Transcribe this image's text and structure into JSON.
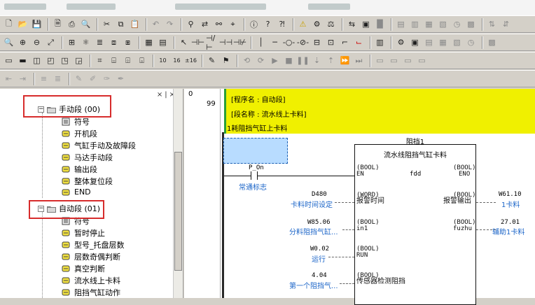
{
  "tree": {
    "header_dots": "×|×",
    "groups": [
      {
        "label": "手动段 (00)",
        "items": [
          "符号",
          "开机段",
          "气缸手动及故障段",
          "马达手动段",
          "输出段",
          "整体复位段",
          "END"
        ]
      },
      {
        "label": "自动段 (01)",
        "items": [
          "符号",
          "暂时停止",
          "型号_托盘层数",
          "层数奇偶判断",
          "真空判断",
          "流水线上卡料",
          "阻挡气缸动作"
        ]
      }
    ]
  },
  "ladder": {
    "rung_start": "0",
    "rung_step": "99",
    "comments": [
      "[程序名 : 自动段]",
      "[段名称 : 流水线上卡料]",
      "1耗阻挡气缸上卡料"
    ],
    "contact": {
      "address": "P_On",
      "comment": "常通标志"
    },
    "function_block": {
      "instance": "阻挡1",
      "name": "流水线阻挡气缸卡料",
      "type_label": "fdd",
      "inputs": [
        {
          "pin_type": "(BOOL)",
          "pin_name": "EN",
          "address": "",
          "comment": ""
        },
        {
          "pin_type": "(WORD)",
          "pin_name": "报警时间",
          "address": "D480",
          "comment": "卡料时间设定"
        },
        {
          "pin_type": "(BOOL)",
          "pin_name": "in1",
          "address": "W85.06",
          "comment": "分料阻挡气缸..."
        },
        {
          "pin_type": "(BOOL)",
          "pin_name": "RUN",
          "address": "W0.02",
          "comment": "运行"
        },
        {
          "pin_type": "(BOOL)",
          "pin_name": "传感器检测阻挡",
          "address": "4.04",
          "comment": "第一个阻挡气..."
        }
      ],
      "outputs": [
        {
          "pin_type": "(BOOL)",
          "pin_name": "ENO",
          "address": "",
          "comment": ""
        },
        {
          "pin_type": "(BOOL)",
          "pin_name": "报警输出",
          "address": "W61.10",
          "comment": "1卡料"
        },
        {
          "pin_type": "(BOOL)",
          "pin_name": "fuzhu",
          "address": "27.01",
          "comment": "辅助1卡料"
        }
      ]
    }
  },
  "toolbar_icons": {
    "row1": [
      "new-icon",
      "open-icon",
      "save-icon",
      "print-preview-icon",
      "print-icon",
      "find-icon",
      "cut-icon",
      "copy-icon",
      "paste-icon",
      "undo-icon",
      "redo-icon",
      "binoculars-icon",
      "replace-icon",
      "cross-ref-icon",
      "address-icon",
      "info-icon",
      "help-icon",
      "warning-icon",
      "online-icon",
      "compare-icon",
      "transfer-icon",
      "monitor-icon",
      "stop-icon",
      "plc-icon",
      "transfer2-icon"
    ],
    "row2": [
      "zoom-icon",
      "zoom-in-icon",
      "zoom-out-icon",
      "fit-icon",
      "grid-icon",
      "network-icon",
      "mnemonic-icon",
      "st-icon",
      "sfc-icon",
      "table-icon",
      "select-icon",
      "contact-no-icon",
      "contact-nc-icon",
      "contact-or-icon",
      "contact-ornc-icon",
      "line-icon",
      "coil-icon",
      "coil-nc-icon",
      "instruction-icon",
      "fb-icon",
      "branch-icon",
      "end-icon"
    ],
    "row3": [
      "project-icon",
      "output-icon",
      "watch-icon",
      "symbols-icon",
      "memory-icon",
      "cross-ref-window-icon",
      "address-ref-icon",
      "io-table-icon",
      "ladder-icon",
      "hex10-icon",
      "hex16-icon",
      "hex16-signed-icon",
      "online-edit-icon",
      "sim-icon",
      "step-icon",
      "run-icon",
      "stop-sim-icon",
      "pause-icon",
      "step-into-icon",
      "step-out-icon",
      "forward-icon"
    ]
  }
}
